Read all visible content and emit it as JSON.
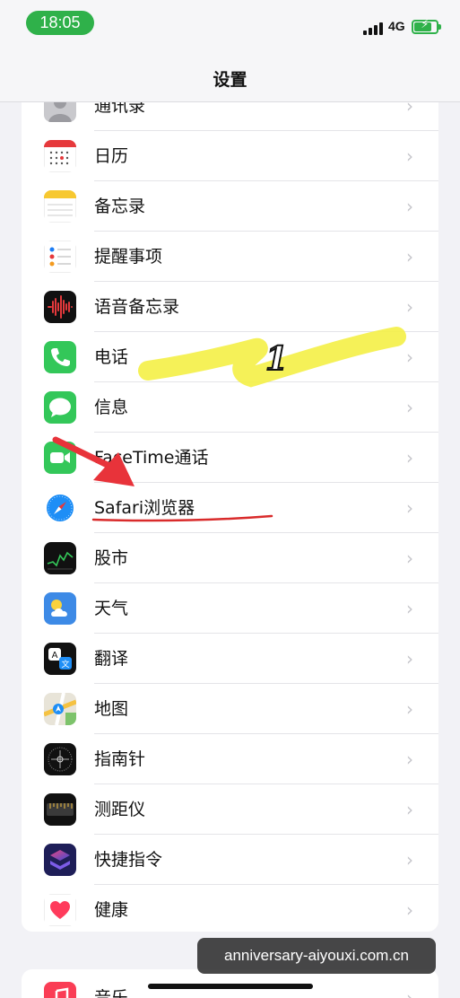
{
  "status_bar": {
    "time": "18:05",
    "network": "4G",
    "battery_level": 0.8,
    "battery_charging": true
  },
  "nav": {
    "title": "设置"
  },
  "rows": [
    {
      "label": "通讯录",
      "icon": "contacts-icon"
    },
    {
      "label": "日历",
      "icon": "calendar-icon"
    },
    {
      "label": "备忘录",
      "icon": "notes-icon"
    },
    {
      "label": "提醒事项",
      "icon": "reminders-icon"
    },
    {
      "label": "语音备忘录",
      "icon": "voice-memos-icon"
    },
    {
      "label": "电话",
      "icon": "phone-icon"
    },
    {
      "label": "信息",
      "icon": "messages-icon"
    },
    {
      "label": "FaceTime通话",
      "icon": "facetime-icon"
    },
    {
      "label": "Safari浏览器",
      "icon": "safari-icon"
    },
    {
      "label": "股市",
      "icon": "stocks-icon"
    },
    {
      "label": "天气",
      "icon": "weather-icon"
    },
    {
      "label": "翻译",
      "icon": "translate-icon"
    },
    {
      "label": "地图",
      "icon": "maps-icon"
    },
    {
      "label": "指南针",
      "icon": "compass-icon"
    },
    {
      "label": "测距仪",
      "icon": "measure-icon"
    },
    {
      "label": "快捷指令",
      "icon": "shortcuts-icon"
    },
    {
      "label": "健康",
      "icon": "health-icon"
    }
  ],
  "second_group": [
    {
      "label": "音乐",
      "icon": "music-icon"
    }
  ],
  "chevron": "›",
  "annotation": {
    "step_number": "1"
  },
  "watermark": "anniversary-aiyouxi.com.cn",
  "colors": {
    "time_pill": "#2fb14a",
    "highlight": "#f4f046",
    "arrow": "#e8333a",
    "underline": "#d92b2b"
  }
}
